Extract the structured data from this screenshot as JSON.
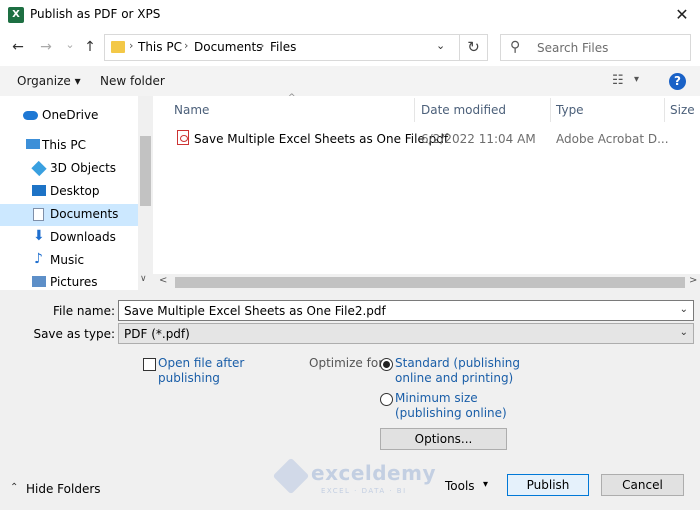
{
  "window": {
    "title": "Publish as PDF or XPS",
    "app_icon": "X",
    "close": "✕"
  },
  "toolbar": {
    "back": "←",
    "forward": "→",
    "recent": "⌄",
    "up": "↑",
    "refresh": "↻",
    "breadcrumb": [
      "This PC",
      "Documents",
      "Files"
    ],
    "crumb_sep": "›",
    "address_dropdown": "⌄",
    "search_placeholder": "Search Files",
    "search_glyph": "⚲"
  },
  "commandbar": {
    "organize": "Organize ▾",
    "new_folder": "New folder",
    "view_glyph": "☷",
    "view_dd": "▾",
    "help": "?"
  },
  "nav_pane": {
    "items": [
      {
        "label": "OneDrive",
        "icon": "cloud-icon",
        "color": "#1e78d4"
      },
      {
        "label": "This PC",
        "icon": "computer-icon",
        "color": "#3c8fd8"
      },
      {
        "label": "3D Objects",
        "icon": "3d-objects-icon",
        "color": "#39a0e0"
      },
      {
        "label": "Desktop",
        "icon": "desktop-icon",
        "color": "#1d73c6"
      },
      {
        "label": "Documents",
        "icon": "documents-icon",
        "color": "#7f8fa8"
      },
      {
        "label": "Downloads",
        "icon": "downloads-icon",
        "color": "#1f6fcf"
      },
      {
        "label": "Music",
        "icon": "music-icon",
        "color": "#1f6fcf"
      },
      {
        "label": "Pictures",
        "icon": "pictures-icon",
        "color": "#5d8fc8"
      }
    ],
    "selected_index": 4,
    "scroll_down": "∨"
  },
  "file_list": {
    "columns": [
      "Name",
      "Date modified",
      "Type",
      "Size"
    ],
    "sort_caret": "^",
    "rows": [
      {
        "name": "Save Multiple Excel Sheets as One File.pdf",
        "date": "6/2/2022 11:04 AM",
        "type": "Adobe Acrobat D..."
      }
    ],
    "scroll_left": "<",
    "scroll_right": ">"
  },
  "form": {
    "file_name_label": "File name:",
    "file_name_value": "Save Multiple Excel Sheets as One File2.pdf",
    "save_type_label": "Save as type:",
    "save_type_value": "PDF (*.pdf)",
    "dropdown_glyph": "⌄",
    "open_after": [
      "Open file after",
      "publishing"
    ],
    "optimize_label": "Optimize for:",
    "standard": [
      "Standard (publishing",
      "online and printing)"
    ],
    "minimum": [
      "Minimum size",
      "(publishing online)"
    ],
    "options_button": "Options..."
  },
  "footer": {
    "hide_caret": "⌃",
    "hide_folders": "Hide Folders",
    "tools": "Tools",
    "tools_caret": "▾",
    "publish": "Publish",
    "cancel": "Cancel"
  },
  "watermark": {
    "name": "exceldemy",
    "tagline": "EXCEL · DATA · BI"
  }
}
